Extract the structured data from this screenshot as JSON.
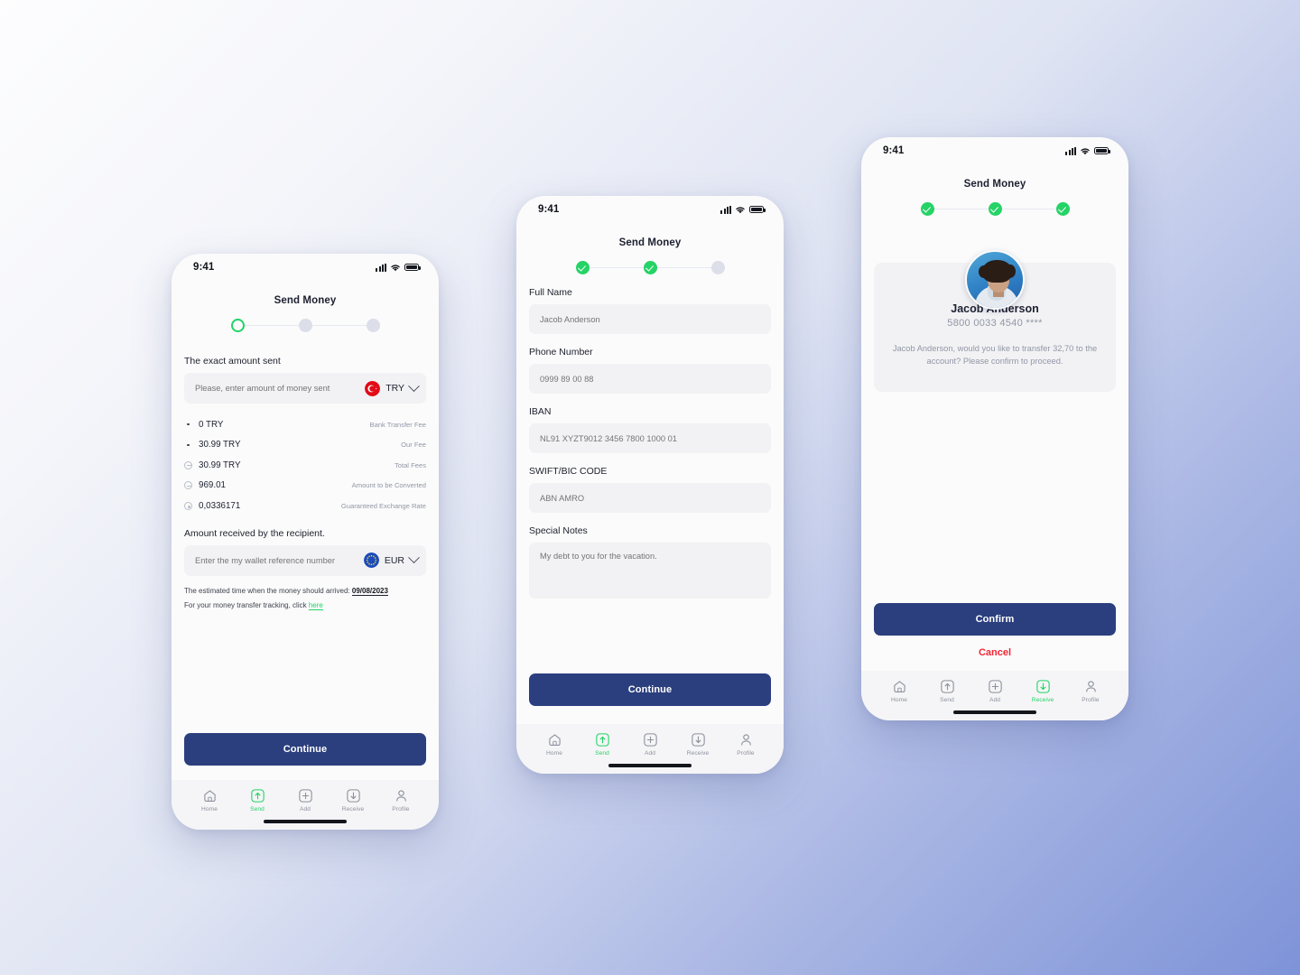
{
  "background": {
    "from": "#fdfdfe",
    "to": "#7e93d8"
  },
  "theme": {
    "primary": "#2b3f7e",
    "success": "#25d366",
    "danger": "#f42534",
    "muted": "#9197a6"
  },
  "statusbar": {
    "time": "9:41"
  },
  "tabbar": {
    "items": [
      {
        "label": "Home",
        "icon": "home-icon"
      },
      {
        "label": "Send",
        "icon": "send-up-arrow-icon"
      },
      {
        "label": "Add",
        "icon": "plus-icon"
      },
      {
        "label": "Receive",
        "icon": "receive-down-arrow-icon"
      },
      {
        "label": "Profile",
        "icon": "person-icon"
      }
    ]
  },
  "phone1": {
    "title": "Send Money",
    "steps": [
      "current",
      "todo",
      "todo"
    ],
    "amount_section_label": "The exact amount sent",
    "amount_input": {
      "placeholder": "Please, enter amount of money sent",
      "value": ""
    },
    "currency_from": {
      "code": "TRY",
      "flag": "turkey-flag-icon"
    },
    "fees": [
      {
        "marker": "dot",
        "value": "0 TRY",
        "label": "Bank Transfer Fee"
      },
      {
        "marker": "dot",
        "value": "30.99 TRY",
        "label": "Our Fee"
      },
      {
        "marker": "minus",
        "value": "30.99 TRY",
        "label": "Total Fees"
      },
      {
        "marker": "minus",
        "value": "969.01",
        "label": "Amount to be Converted"
      },
      {
        "marker": "target",
        "value": "0,0336171",
        "label": "Guaranteed Exchange Rate"
      }
    ],
    "recipient_section_label": "Amount received by the recipient.",
    "wallet_input": {
      "placeholder": "Enter the my wallet reference number",
      "value": ""
    },
    "currency_to": {
      "code": "EUR",
      "flag": "eu-flag-icon"
    },
    "eta_prefix": "The estimated time when the money should arrived:",
    "eta_date": "09/08/2023",
    "tracking_prefix": "For your money transfer tracking, click",
    "tracking_link": "here",
    "continue_label": "Continue",
    "active_tab": "Send"
  },
  "phone2": {
    "title": "Send Money",
    "steps": [
      "done",
      "done",
      "todo"
    ],
    "fields": [
      {
        "label": "Full Name",
        "placeholder": "Jacob Anderson",
        "value": ""
      },
      {
        "label": "Phone Number",
        "placeholder": "0999 89 00 88",
        "value": ""
      },
      {
        "label": "IBAN",
        "placeholder": "NL91 XYZT9012 3456 7800 1000 01",
        "value": ""
      },
      {
        "label": "SWIFT/BIC CODE",
        "placeholder": "ABN AMRO",
        "value": ""
      },
      {
        "label": "Special Notes",
        "placeholder": "My debt to you for the vacation.",
        "value": ""
      }
    ],
    "continue_label": "Continue",
    "active_tab": "Send"
  },
  "phone3": {
    "title": "Send Money",
    "steps": [
      "done",
      "done",
      "done"
    ],
    "avatar_alt": "jacob-anderson-avatar",
    "name": "Jacob Anderson",
    "card_number": "5800 0033 4540 ****",
    "message": "Jacob Anderson, would you like to transfer 32,70 to the account? Please confirm to proceed.",
    "confirm_label": "Confirm",
    "cancel_label": "Cancel",
    "active_tab": "Receive"
  }
}
